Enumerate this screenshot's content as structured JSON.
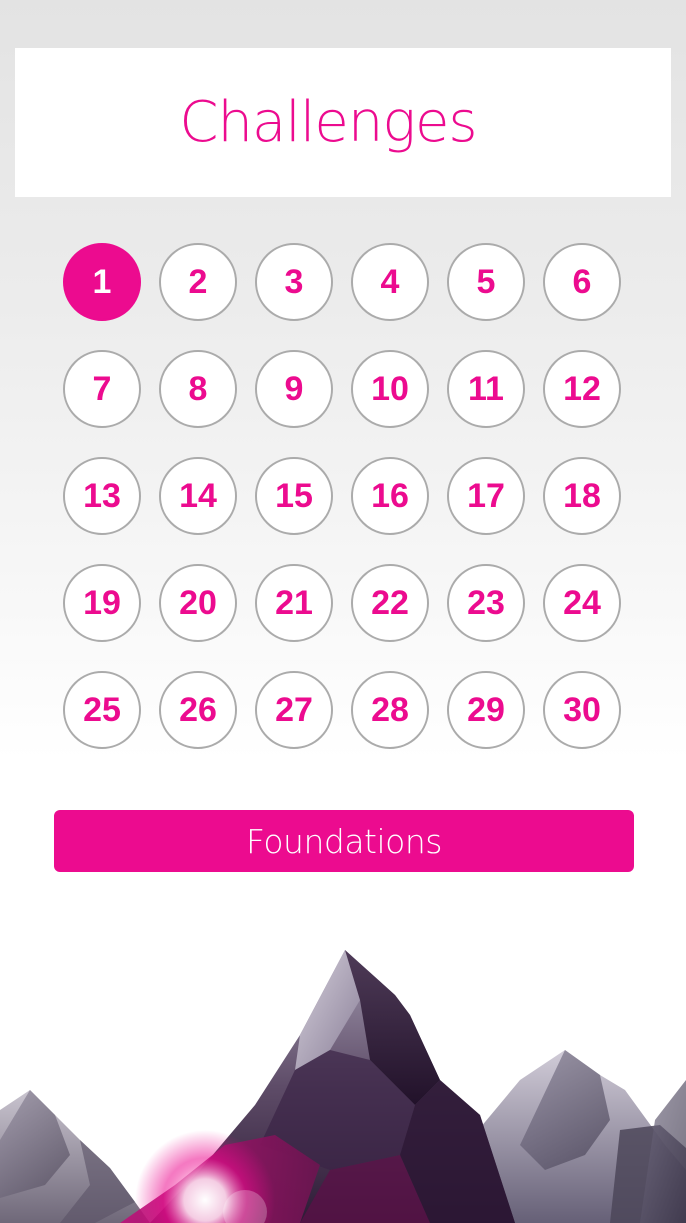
{
  "header": {
    "title": "Challenges"
  },
  "levels": [
    {
      "label": "1",
      "selected": true
    },
    {
      "label": "2",
      "selected": false
    },
    {
      "label": "3",
      "selected": false
    },
    {
      "label": "4",
      "selected": false
    },
    {
      "label": "5",
      "selected": false
    },
    {
      "label": "6",
      "selected": false
    },
    {
      "label": "7",
      "selected": false
    },
    {
      "label": "8",
      "selected": false
    },
    {
      "label": "9",
      "selected": false
    },
    {
      "label": "10",
      "selected": false
    },
    {
      "label": "11",
      "selected": false
    },
    {
      "label": "12",
      "selected": false
    },
    {
      "label": "13",
      "selected": false
    },
    {
      "label": "14",
      "selected": false
    },
    {
      "label": "15",
      "selected": false
    },
    {
      "label": "16",
      "selected": false
    },
    {
      "label": "17",
      "selected": false
    },
    {
      "label": "18",
      "selected": false
    },
    {
      "label": "19",
      "selected": false
    },
    {
      "label": "20",
      "selected": false
    },
    {
      "label": "21",
      "selected": false
    },
    {
      "label": "22",
      "selected": false
    },
    {
      "label": "23",
      "selected": false
    },
    {
      "label": "24",
      "selected": false
    },
    {
      "label": "25",
      "selected": false
    },
    {
      "label": "26",
      "selected": false
    },
    {
      "label": "27",
      "selected": false
    },
    {
      "label": "28",
      "selected": false
    },
    {
      "label": "29",
      "selected": false
    },
    {
      "label": "30",
      "selected": false
    }
  ],
  "pack_button": {
    "label": "Foundations"
  },
  "colors": {
    "accent": "#ec0b8f",
    "circle_border": "#ababab",
    "background_top": "#e3e3e3",
    "background_bottom": "#ffffff"
  },
  "decoration": {
    "icon": "mountains-illustration"
  }
}
